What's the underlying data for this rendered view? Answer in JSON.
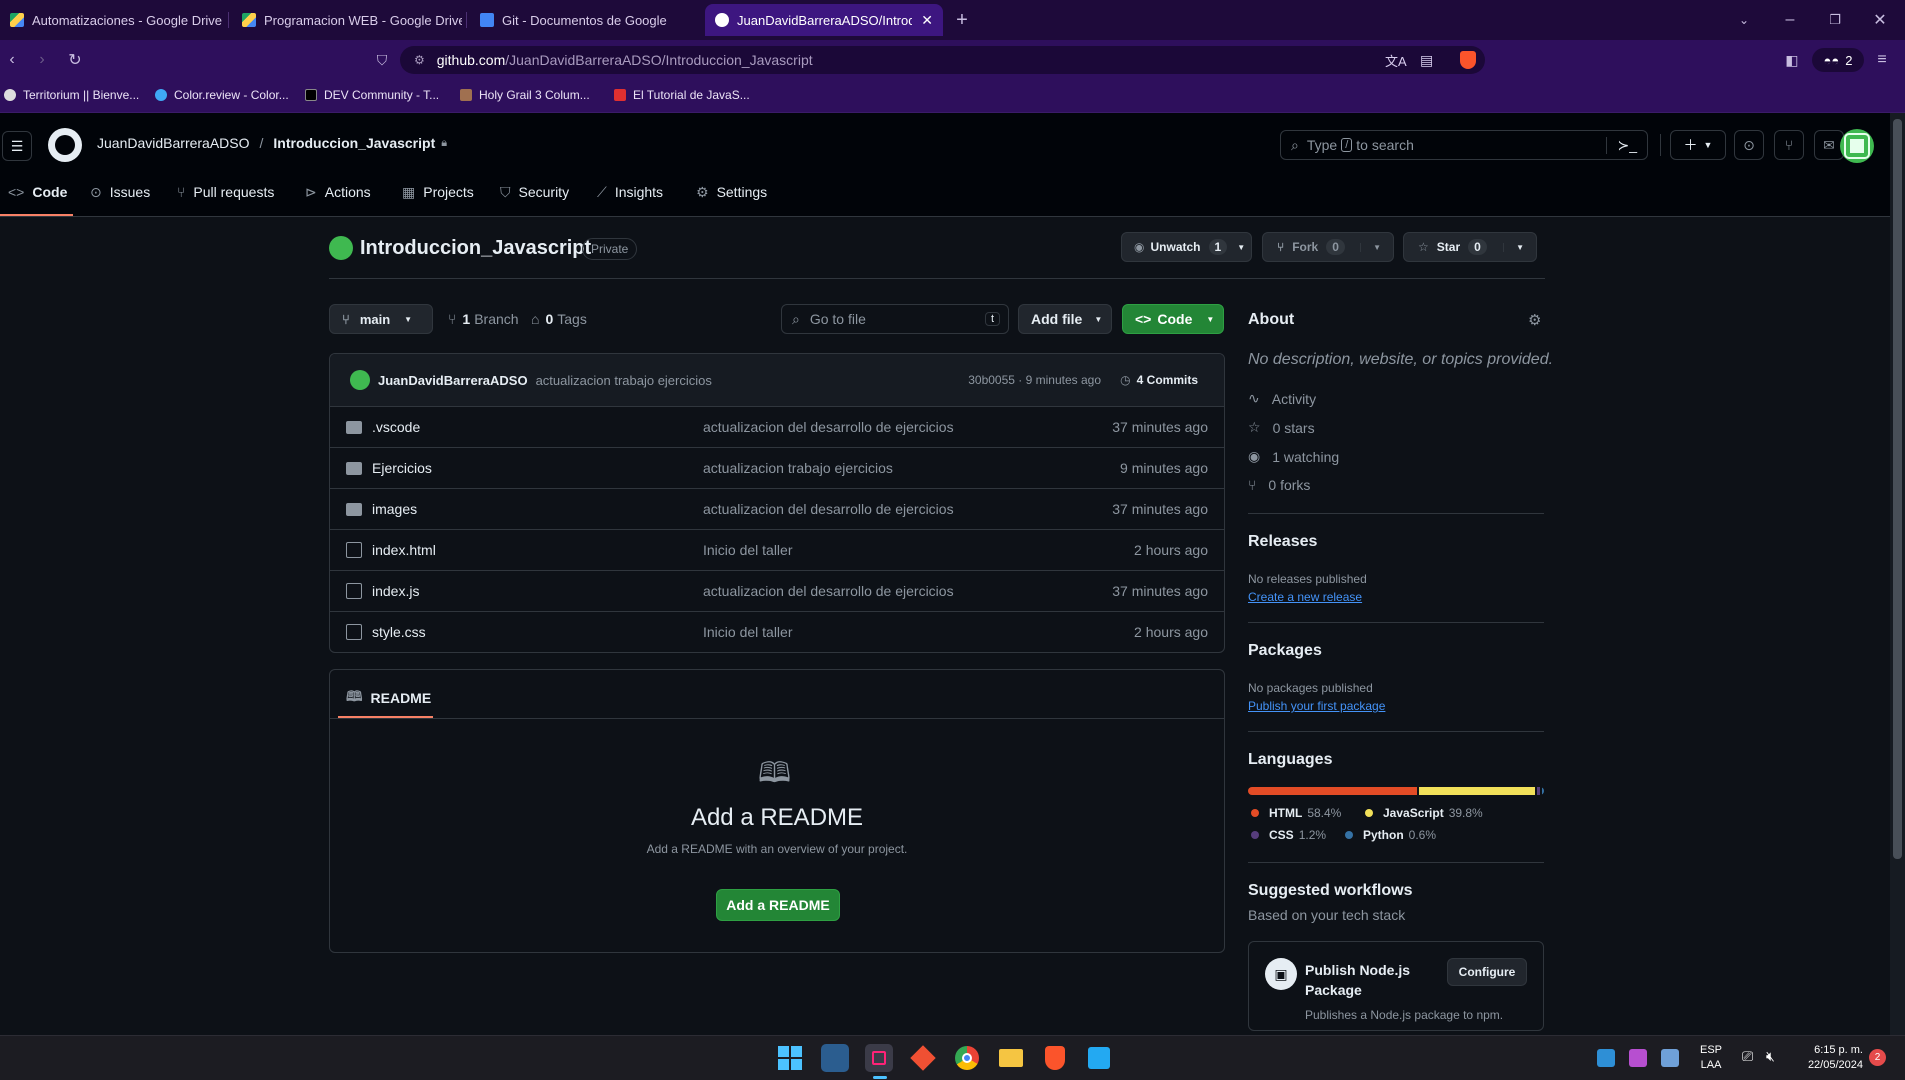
{
  "browser": {
    "tabs": [
      {
        "label": "Automatizaciones - Google Drive"
      },
      {
        "label": "Programacion WEB - Google Drive"
      },
      {
        "label": "Git - Documentos de Google"
      },
      {
        "label": "JuanDavidBarreraADSO/Introdu"
      }
    ],
    "url_host": "github.com",
    "url_path": "/JuanDavidBarreraADSO/Introduccion_Javascript",
    "shields_count": "2",
    "bookmarks": [
      {
        "label": "Territorium || Bienve..."
      },
      {
        "label": "Color.review - Color..."
      },
      {
        "label": "DEV Community - T..."
      },
      {
        "label": "Holy Grail 3 Colum..."
      },
      {
        "label": "El Tutorial de JavaS..."
      }
    ]
  },
  "header": {
    "owner": "JuanDavidBarreraADSO",
    "separator": "/",
    "repo": "Introduccion_Javascript",
    "search_placeholder_pre": "Type",
    "search_key": "/",
    "search_placeholder_post": "to search"
  },
  "repo_tabs": [
    {
      "label": "Code"
    },
    {
      "label": "Issues"
    },
    {
      "label": "Pull requests"
    },
    {
      "label": "Actions"
    },
    {
      "label": "Projects"
    },
    {
      "label": "Security"
    },
    {
      "label": "Insights"
    },
    {
      "label": "Settings"
    }
  ],
  "repo": {
    "name": "Introduccion_Javascript",
    "visibility": "Private",
    "unwatch_label": "Unwatch",
    "watch_count": "1",
    "fork_label": "Fork",
    "fork_count": "0",
    "star_label": "Star",
    "star_count": "0"
  },
  "toolbar": {
    "branch": "main",
    "branches_count": "1",
    "branches_label": "Branch",
    "tags_count": "0",
    "tags_label": "Tags",
    "goto_placeholder": "Go to file",
    "goto_key": "t",
    "add_file": "Add file",
    "code": "Code"
  },
  "commit": {
    "author": "JuanDavidBarreraADSO",
    "message": "actualizacion trabajo ejercicios",
    "hash_time": "30b0055 · 9 minutes ago",
    "commits": "4 Commits"
  },
  "files": [
    {
      "name": ".vscode",
      "type": "folder",
      "message": "actualizacion del desarrollo de ejercicios",
      "time": "37 minutes ago"
    },
    {
      "name": "Ejercicios",
      "type": "folder",
      "message": "actualizacion trabajo ejercicios",
      "time": "9 minutes ago"
    },
    {
      "name": "images",
      "type": "folder",
      "message": "actualizacion del desarrollo de ejercicios",
      "time": "37 minutes ago"
    },
    {
      "name": "index.html",
      "type": "file",
      "message": "Inicio del taller",
      "time": "2 hours ago"
    },
    {
      "name": "index.js",
      "type": "file",
      "message": "actualizacion del desarrollo de ejercicios",
      "time": "37 minutes ago"
    },
    {
      "name": "style.css",
      "type": "file",
      "message": "Inicio del taller",
      "time": "2 hours ago"
    }
  ],
  "readme": {
    "tab": "README",
    "title": "Add a README",
    "subtitle": "Add a README with an overview of your project.",
    "button": "Add a README"
  },
  "about": {
    "title": "About",
    "description": "No description, website, or topics provided.",
    "activity": "Activity",
    "stars": "0 stars",
    "watching": "1 watching",
    "forks": "0 forks"
  },
  "releases": {
    "title": "Releases",
    "empty": "No releases published",
    "link": "Create a new release"
  },
  "packages": {
    "title": "Packages",
    "empty": "No packages published",
    "link": "Publish your first package"
  },
  "languages": {
    "title": "Languages",
    "items": [
      {
        "name": "HTML",
        "percent": "58.4%",
        "value": 58.4,
        "color": "#e34c26"
      },
      {
        "name": "JavaScript",
        "percent": "39.8%",
        "value": 39.8,
        "color": "#f1e05a"
      },
      {
        "name": "CSS",
        "percent": "1.2%",
        "value": 1.2,
        "color": "#563d7c"
      },
      {
        "name": "Python",
        "percent": "0.6%",
        "value": 0.6,
        "color": "#3572A5"
      }
    ]
  },
  "workflows": {
    "title": "Suggested workflows",
    "subtitle": "Based on your tech stack",
    "card_title": "Publish Node.js Package",
    "card_desc": "Publishes a Node.js package to npm.",
    "configure": "Configure"
  },
  "taskbar": {
    "lang1": "ESP",
    "lang2": "LAA",
    "time": "6:15 p. m.",
    "date": "22/05/2024",
    "notifications": "2"
  },
  "colors": {
    "accent_green": "#238636",
    "tab_underline": "#f78166",
    "link": "#4493f8"
  }
}
